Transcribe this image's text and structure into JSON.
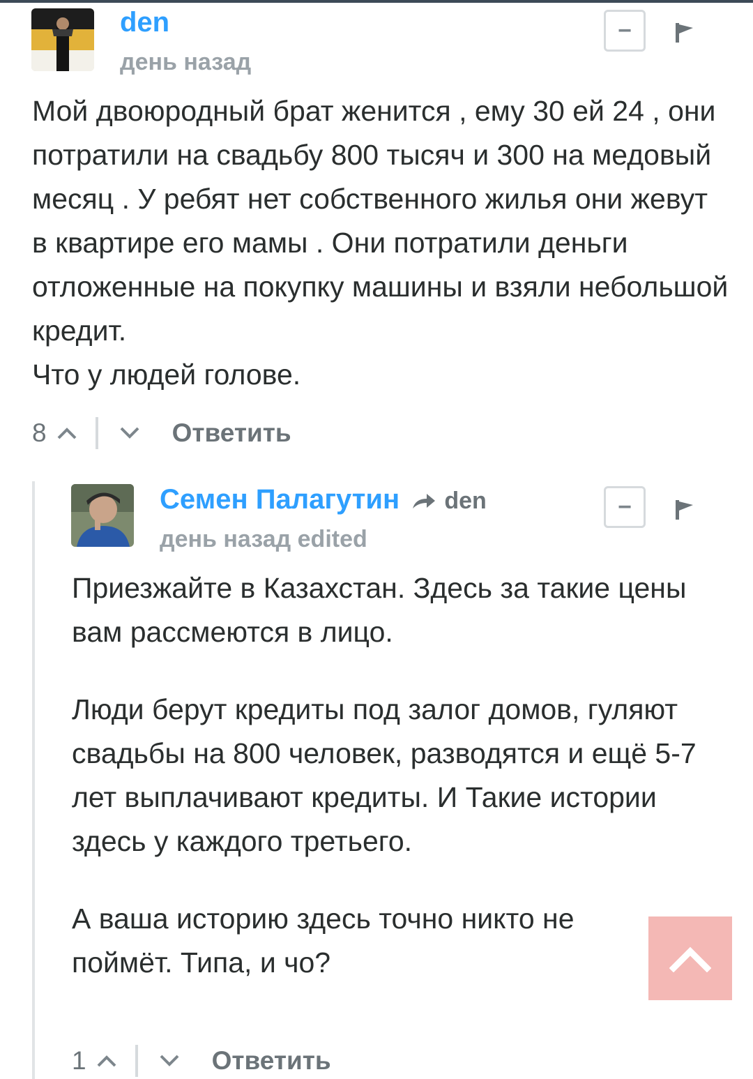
{
  "comments": [
    {
      "author": "den",
      "time": "день назад",
      "body": [
        "Мой двоюродный брат женится , ему 30 ей 24 , они потратили на свадьбу 800 тысяч и 300 на медовый месяц . У ребят нет собственного жилья они жевут в квартире его мамы . Они потратили деньги отложенные на покупку машины и взяли небольшой кредит.",
        "Что у людей голове."
      ],
      "votes": "8",
      "reply_label": "Ответить",
      "collapse_label": "−"
    },
    {
      "author": "Семен Палагутин",
      "reply_to": "den",
      "time": "день назад",
      "edited": "edited",
      "body": [
        "Приезжайте в Казахстан. Здесь за такие цены вам рассмеются в лицо.",
        "Люди берут кредиты под залог домов, гуляют свадьбы на 800 человек, разводятся и ещё 5-7 лет выплачивают кредиты. И Такие истории здесь у каждого третьего.",
        "А ваша историю здесь точно никто не поймёт. Типа, и чо?"
      ],
      "votes": "1",
      "reply_label": "Ответить",
      "collapse_label": "−"
    }
  ],
  "icons": {
    "flag": "flag-icon",
    "vote_up": "chevron-up-icon",
    "vote_down": "chevron-down-icon",
    "reply_arrow": "share-arrow-icon",
    "scroll_top": "chevron-up-icon"
  },
  "colors": {
    "author": "#2e9fff",
    "meta": "#9aa2a8",
    "text": "#2a2e2e",
    "scroll_top_bg": "#f4b8b5"
  }
}
